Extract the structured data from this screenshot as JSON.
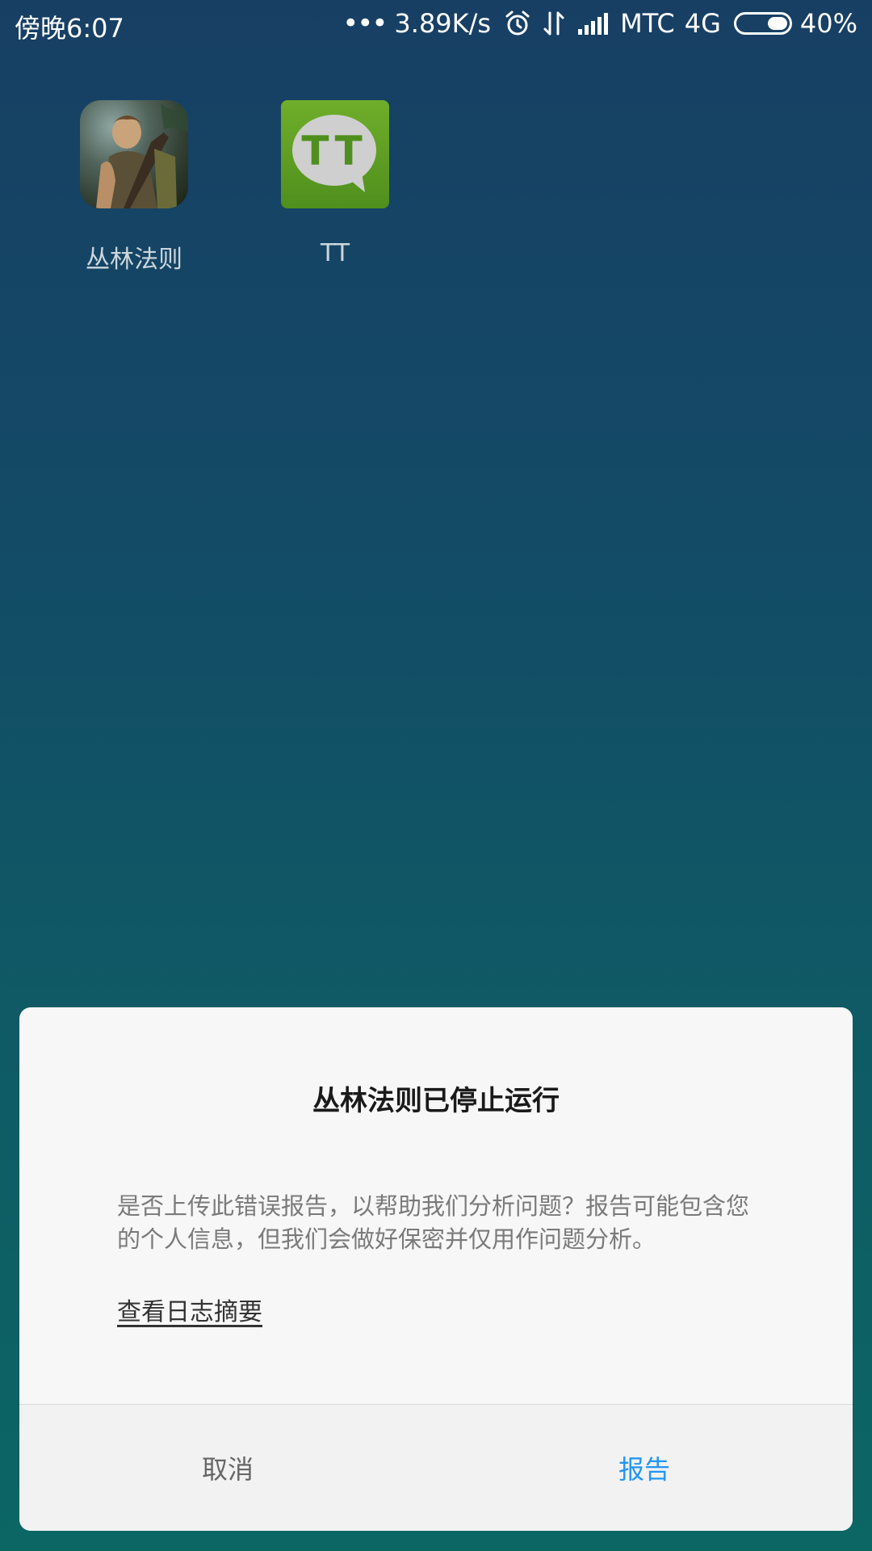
{
  "status_bar": {
    "time": "傍晚6:07",
    "dots": "•••",
    "network_speed": "3.89K/s",
    "carrier": "MTC",
    "network_type": "4G",
    "battery": "40%",
    "battery_level": 0.4,
    "icons": [
      "alarm-icon",
      "data-transfer-icon",
      "signal-icon",
      "battery-icon"
    ]
  },
  "home": {
    "apps": [
      {
        "label": "丛林法则",
        "icon": "jungle-game-app-icon"
      },
      {
        "label": "TT",
        "icon": "tt-chat-app-icon",
        "icon_text": "TT",
        "color": "#5a9a22"
      }
    ]
  },
  "dialog": {
    "title": "丛林法则已停止运行",
    "message": "是否上传此错误报告，以帮助我们分析问题？报告可能包含您的个人信息，但我们会做好保密并仅用作问题分析。",
    "link": "查看日志摘要",
    "cancel_label": "取消",
    "report_label": "报告",
    "accent_color": "#2196f3"
  }
}
